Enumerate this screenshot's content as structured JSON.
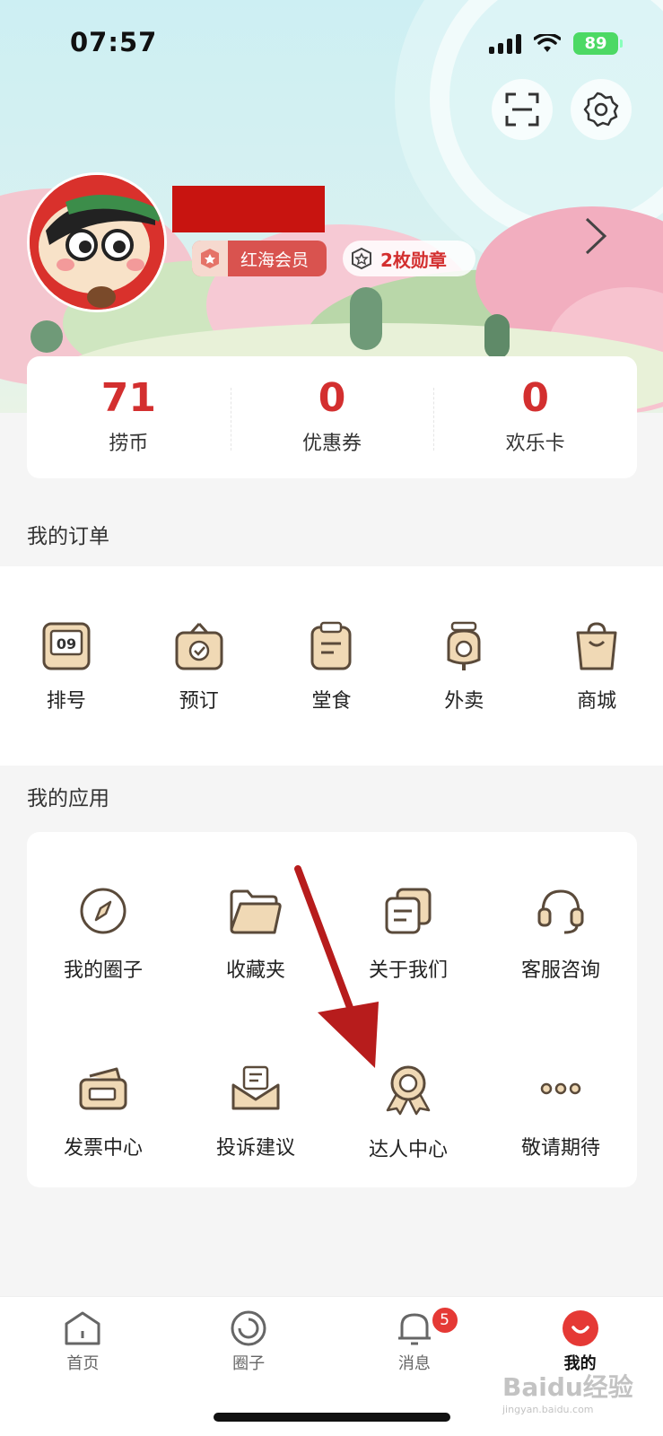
{
  "status_bar": {
    "time": "07:57",
    "battery": "89"
  },
  "profile": {
    "vip_label": "红海会员",
    "medal_label": "2枚勋章"
  },
  "stats": [
    {
      "value": "71",
      "label": "捞币"
    },
    {
      "value": "0",
      "label": "优惠券"
    },
    {
      "value": "0",
      "label": "欢乐卡"
    }
  ],
  "orders": {
    "title": "我的订单",
    "items": [
      {
        "label": "排号",
        "icon": "queue-number-icon",
        "icon_text": "09"
      },
      {
        "label": "预订",
        "icon": "reservation-icon"
      },
      {
        "label": "堂食",
        "icon": "dine-in-icon"
      },
      {
        "label": "外卖",
        "icon": "delivery-scooter-icon"
      },
      {
        "label": "商城",
        "icon": "shopping-bag-icon"
      }
    ]
  },
  "apps": {
    "title": "我的应用",
    "items": [
      {
        "label": "我的圈子",
        "icon": "compass-icon"
      },
      {
        "label": "收藏夹",
        "icon": "folder-icon"
      },
      {
        "label": "关于我们",
        "icon": "documents-icon"
      },
      {
        "label": "客服咨询",
        "icon": "headset-icon"
      },
      {
        "label": "发票中心",
        "icon": "invoice-icon"
      },
      {
        "label": "投诉建议",
        "icon": "mail-icon"
      },
      {
        "label": "达人中心",
        "icon": "award-icon"
      },
      {
        "label": "敬请期待",
        "icon": "more-icon"
      }
    ]
  },
  "tabbar": {
    "items": [
      {
        "label": "首页",
        "icon": "home-icon"
      },
      {
        "label": "圈子",
        "icon": "circle-icon"
      },
      {
        "label": "消息",
        "icon": "bell-icon",
        "badge": "5"
      },
      {
        "label": "我的",
        "icon": "profile-icon"
      }
    ]
  },
  "watermark": {
    "text": "Baidu经验",
    "sub": "jingyan.baidu.com"
  },
  "colors": {
    "accent": "#d32f2f",
    "icon_fill": "#f0d9b5",
    "icon_stroke": "#5a4a3a"
  }
}
